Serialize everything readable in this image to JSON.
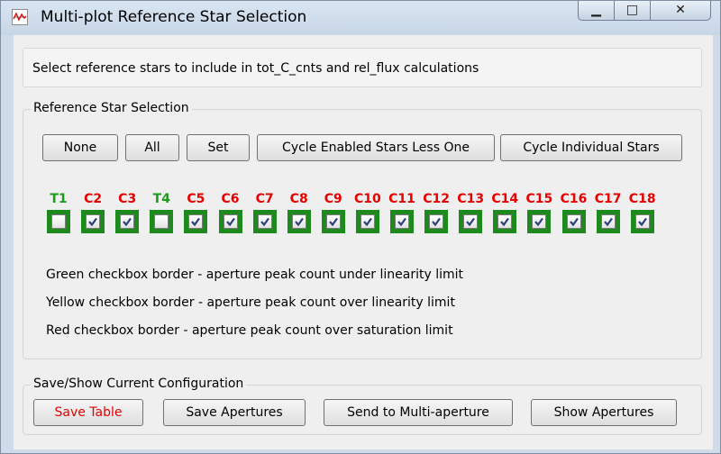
{
  "window": {
    "title": "Multi-plot Reference Star Selection",
    "controls": {
      "minimize": "▁",
      "maximize": "□",
      "close": "✕"
    }
  },
  "info": {
    "text": "Select reference stars to include in tot_C_cnts and rel_flux calculations"
  },
  "selection": {
    "title": "Reference Star Selection",
    "buttons": [
      "None",
      "All",
      "Set",
      "Cycle Enabled Stars Less One",
      "Cycle Individual Stars"
    ],
    "stars": [
      {
        "label": "T1",
        "checked": false,
        "label_color": "#1e9a1e",
        "border": "green"
      },
      {
        "label": "C2",
        "checked": true,
        "label_color": "#e60000",
        "border": "green"
      },
      {
        "label": "C3",
        "checked": true,
        "label_color": "#e60000",
        "border": "green"
      },
      {
        "label": "T4",
        "checked": false,
        "label_color": "#1e9a1e",
        "border": "green"
      },
      {
        "label": "C5",
        "checked": true,
        "label_color": "#e60000",
        "border": "green"
      },
      {
        "label": "C6",
        "checked": true,
        "label_color": "#e60000",
        "border": "green"
      },
      {
        "label": "C7",
        "checked": true,
        "label_color": "#e60000",
        "border": "green"
      },
      {
        "label": "C8",
        "checked": true,
        "label_color": "#e60000",
        "border": "green"
      },
      {
        "label": "C9",
        "checked": true,
        "label_color": "#e60000",
        "border": "green"
      },
      {
        "label": "C10",
        "checked": true,
        "label_color": "#e60000",
        "border": "green"
      },
      {
        "label": "C11",
        "checked": true,
        "label_color": "#e60000",
        "border": "green"
      },
      {
        "label": "C12",
        "checked": true,
        "label_color": "#e60000",
        "border": "green"
      },
      {
        "label": "C13",
        "checked": true,
        "label_color": "#e60000",
        "border": "green"
      },
      {
        "label": "C14",
        "checked": true,
        "label_color": "#e60000",
        "border": "green"
      },
      {
        "label": "C15",
        "checked": true,
        "label_color": "#e60000",
        "border": "green"
      },
      {
        "label": "C16",
        "checked": true,
        "label_color": "#e60000",
        "border": "green"
      },
      {
        "label": "C17",
        "checked": true,
        "label_color": "#e60000",
        "border": "green"
      },
      {
        "label": "C18",
        "checked": true,
        "label_color": "#e60000",
        "border": "green"
      }
    ],
    "legend": [
      "Green checkbox border - aperture peak count under linearity limit",
      "Yellow checkbox border - aperture peak count over linearity limit",
      "Red checkbox border - aperture peak count over saturation limit"
    ]
  },
  "save": {
    "title": "Save/Show Current Configuration",
    "buttons": [
      {
        "label": "Save Table",
        "color": "#e60000"
      },
      {
        "label": "Save Apertures",
        "color": "#000000"
      },
      {
        "label": "Send to Multi-aperture",
        "color": "#000000"
      },
      {
        "label": "Show Apertures",
        "color": "#000000"
      }
    ]
  },
  "colors": {
    "accent_green": "#1e8a1e",
    "target_label": "#1e9a1e",
    "comp_label": "#e60000"
  }
}
